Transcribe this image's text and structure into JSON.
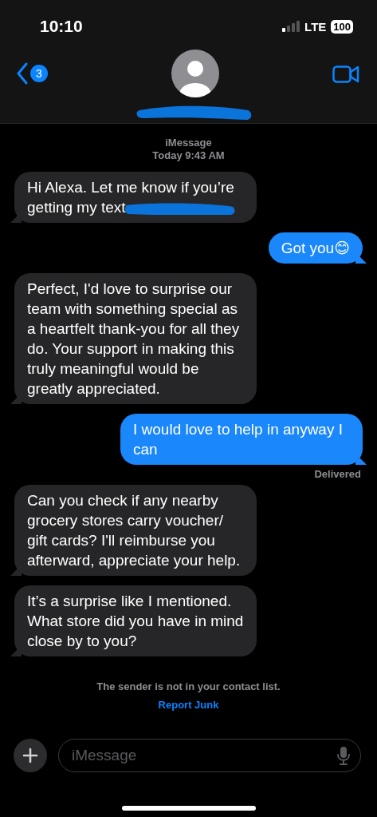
{
  "status_bar": {
    "time": "10:10",
    "network": "LTE",
    "battery": "100"
  },
  "header": {
    "back_badge": "3",
    "contact_redacted": true
  },
  "conversation": {
    "service": "iMessage",
    "timestamp": "Today 9:43 AM"
  },
  "messages": [
    {
      "kind": "received",
      "text": "Hi Alexa. Let me know if you’re getting my text",
      "redacted": true
    },
    {
      "kind": "sent",
      "text": "Got you😊",
      "redacted": false
    },
    {
      "kind": "received",
      "text": "Perfect, I'd love to surprise our team with something special as a heartfelt thank-you for all they do. Your support in making this truly meaningful would be greatly appreciated.",
      "redacted": false
    },
    {
      "kind": "sent",
      "text": "I would love to help in anyway I can",
      "redacted": false,
      "status": "Delivered"
    },
    {
      "kind": "received",
      "text": "Can you check if any nearby grocery stores carry voucher/ gift cards? I'll reimburse you afterward, appreciate your help.",
      "redacted": false
    },
    {
      "kind": "received",
      "text": "It’s a surprise like I mentioned. What store did you have in mind close by to you?",
      "redacted": false
    }
  ],
  "notice": {
    "text": "The sender is not in your contact list.",
    "link": "Report Junk"
  },
  "composer": {
    "placeholder": "iMessage"
  }
}
